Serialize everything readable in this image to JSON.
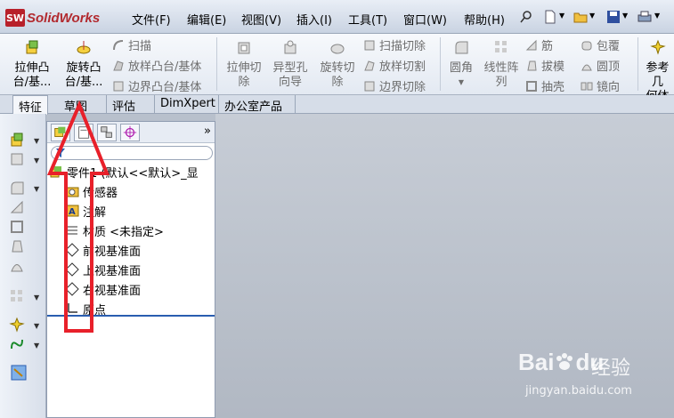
{
  "app": {
    "logo_mark": "SW",
    "logo_text": "SolidWorks"
  },
  "menubar": {
    "items": [
      {
        "label": "文件(F)"
      },
      {
        "label": "编辑(E)"
      },
      {
        "label": "视图(V)"
      },
      {
        "label": "插入(I)"
      },
      {
        "label": "工具(T)"
      },
      {
        "label": "窗口(W)"
      },
      {
        "label": "帮助(H)"
      }
    ],
    "icons": [
      "pin-icon",
      "new-file-icon",
      "open-folder-icon",
      "save-icon",
      "print-icon"
    ]
  },
  "ribbon": {
    "extrude_boss": "拉伸凸\n台/基...",
    "revolve_boss": "旋转凸\n台/基...",
    "sweep": "扫描",
    "loft_boss": "放样凸台/基体",
    "boundary_boss": "边界凸台/基体",
    "extrude_cut": "拉伸切\n除",
    "hole_wizard": "异型孔\n向导",
    "revolve_cut": "旋转切\n除",
    "swept_cut": "扫描切除",
    "lofted_cut": "放样切割",
    "boundary_cut": "边界切除",
    "fillet": "圆角",
    "linear_pattern": "线性阵\n列",
    "rib": "筋",
    "draft": "拔模",
    "shell": "抽壳",
    "wrap": "包覆",
    "dome": "圆顶",
    "mirror": "镜向",
    "ref_geometry": "参考几\n何体"
  },
  "tabs": [
    {
      "label": "特征",
      "active": true
    },
    {
      "label": "草图",
      "active": false
    },
    {
      "label": "评估",
      "active": false
    },
    {
      "label": "DimXpert",
      "active": false
    },
    {
      "label": "办公室产品",
      "active": false
    }
  ],
  "feature_manager": {
    "expand_symbol": "»",
    "tree": [
      {
        "label": "零件1 (默认<<默认>_显",
        "icon": "part-icon"
      },
      {
        "label": "传感器",
        "icon": "sensor-icon"
      },
      {
        "label": "注解",
        "icon": "annotation-icon"
      },
      {
        "label": "材质 <未指定>",
        "icon": "material-icon"
      },
      {
        "label": "前视基准面",
        "icon": "plane-icon"
      },
      {
        "label": "上视基准面",
        "icon": "plane-icon"
      },
      {
        "label": "右视基准面",
        "icon": "plane-icon"
      },
      {
        "label": "原点",
        "icon": "origin-icon"
      }
    ]
  },
  "watermark": {
    "brand": "Bai",
    "brand2": "du",
    "sub": "经验",
    "url": "jingyan.baidu.com"
  },
  "colors": {
    "annotation_arrow": "#e8202a",
    "brand_red": "#b8202a",
    "selection_blue": "#2a5db0"
  }
}
